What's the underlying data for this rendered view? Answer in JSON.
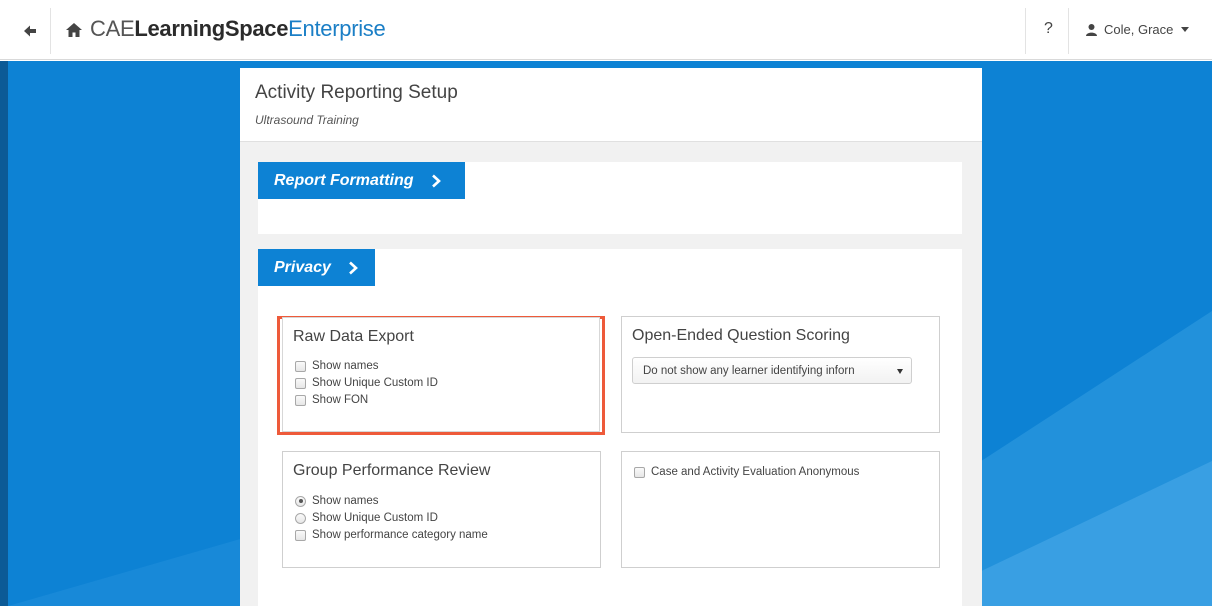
{
  "navbar": {
    "brand_prefix": "CAE",
    "brand_main": "LearningSpace",
    "brand_suffix": "Enterprise",
    "help_label": "?",
    "user_name": "Cole, Grace",
    "back_icon": "arrow-left-icon",
    "home_icon": "home-icon",
    "user_icon": "user-icon"
  },
  "page": {
    "title": "Activity Reporting Setup",
    "subtitle": "Ultrasound Training"
  },
  "sections": {
    "report_formatting": {
      "label": "Report Formatting"
    },
    "privacy": {
      "label": "Privacy"
    }
  },
  "raw_data_export": {
    "title": "Raw Data Export",
    "options": [
      {
        "label": "Show names",
        "checked": false
      },
      {
        "label": "Show Unique Custom ID",
        "checked": false
      },
      {
        "label": "Show FON",
        "checked": false
      }
    ]
  },
  "open_ended": {
    "title": "Open-Ended Question Scoring",
    "selected": "Do not show any learner identifying inforn"
  },
  "group_review": {
    "title": "Group Performance Review",
    "radio_options": [
      {
        "label": "Show names",
        "selected": true
      },
      {
        "label": "Show Unique Custom ID",
        "selected": false
      }
    ],
    "checkbox_option": {
      "label": "Show performance category name",
      "checked": false
    }
  },
  "case_eval": {
    "label": "Case and Activity Evaluation Anonymous",
    "checked": false
  },
  "colors": {
    "accent": "#0d82d4",
    "highlight": "#ee5a3a",
    "brand_suffix": "#1b7fc6"
  }
}
